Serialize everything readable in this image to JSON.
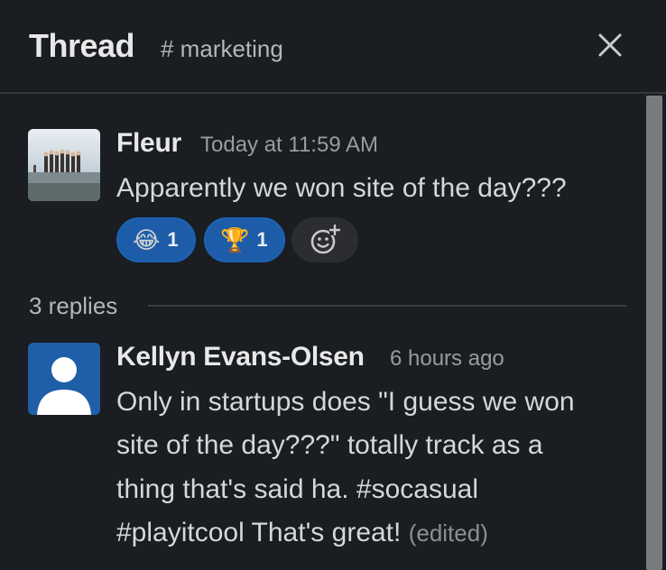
{
  "header": {
    "title": "Thread",
    "channel": "# marketing"
  },
  "messages": [
    {
      "author": "Fleur",
      "time": "Today at 11:59 AM",
      "text": "Apparently we won site of the day???",
      "reactions": [
        {
          "emoji": "😂",
          "count": "1"
        },
        {
          "emoji": "🏆",
          "count": "1"
        }
      ]
    }
  ],
  "replies": {
    "count_label": "3 replies"
  },
  "reply_messages": [
    {
      "author": "Kellyn Evans-Olsen",
      "time": "6 hours ago",
      "lines": [
        "Only in startups does \"I guess we won",
        "site of the day???\" totally track as a",
        "thing that's said ha. #socasual",
        "#playitcool That's great!"
      ],
      "edited": "(edited)"
    }
  ],
  "colors": {
    "background": "#1a1d21",
    "reaction_bg": "#1d5ca8",
    "divider": "#34373b"
  },
  "icons": {
    "close": "close-icon",
    "add_reaction": "add-reaction-icon"
  }
}
